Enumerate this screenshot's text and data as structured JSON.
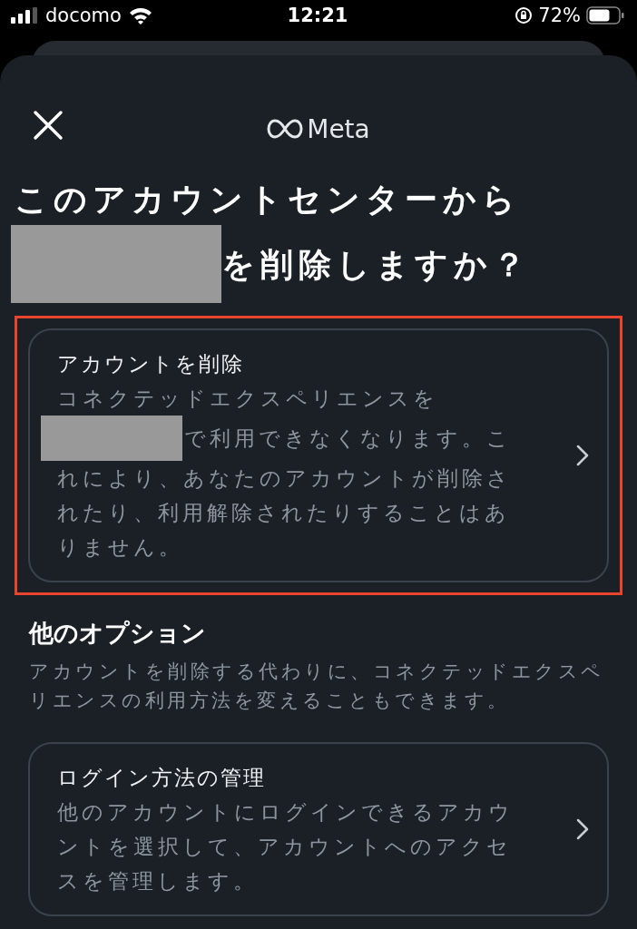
{
  "status_bar": {
    "carrier": "docomo",
    "time": "12:21",
    "battery": "72%"
  },
  "header": {
    "logo": "Meta"
  },
  "title": {
    "line_1": "このアカウントセンターから",
    "line_2_after_redaction": "を削除しますか？"
  },
  "primary_option": {
    "title": "アカウントを削除",
    "description_before": "コネクテッドエクスペリエンスを",
    "description_after_redaction": "で利用できなくなります。こ",
    "description_rest": "れにより、あなたのアカウントが削除されたり、利用解除されたりすることはありません。",
    "highlighted": true
  },
  "other_options": {
    "heading": "他のオプション",
    "description": "アカウントを削除する代わりに、コネクテッドエクスペリエンスの利用方法を変えることもできます。",
    "items": [
      {
        "title": "ログイン方法の管理",
        "description": "他のアカウントにログインできるアカウントを選択して、アカウントへのアクセスを管理します。",
        "highlighted": false
      }
    ]
  }
}
